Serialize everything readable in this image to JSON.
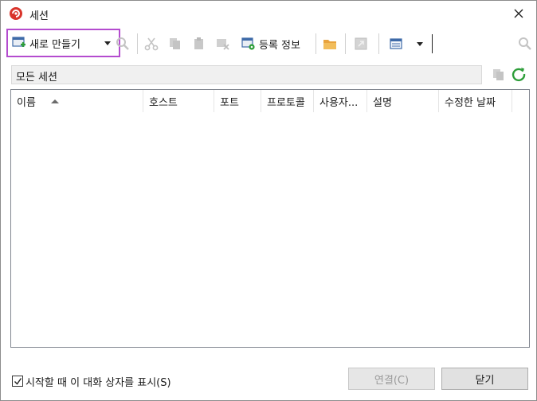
{
  "window": {
    "title": "세션",
    "close_icon": "close-icon"
  },
  "toolbar": {
    "new_session_label": "새로 만들기",
    "register_info_label": "등록 정보",
    "search_value": "",
    "icons": [
      "new-session-icon",
      "find-icon",
      "cut-icon",
      "copy-icon",
      "paste-icon",
      "delete-icon",
      "register-info-icon",
      "open-folder-icon",
      "shortcut-icon",
      "view-mode-icon",
      "search-icon"
    ]
  },
  "filter": {
    "label": "모든 세션"
  },
  "list": {
    "columns": [
      "이름",
      "호스트",
      "포트",
      "프로토콜",
      "사용자...",
      "설명",
      "수정한 날짜"
    ],
    "sort_column": "이름",
    "sort_direction": "ascending",
    "rows": []
  },
  "footer": {
    "show_on_startup_label": "시작할 때 이 대화 상자를 표시(S)",
    "show_on_startup_checked": true,
    "connect_label": "연결(C)",
    "close_label": "닫기"
  },
  "colors": {
    "highlight_border": "#b44ccf",
    "refresh_green": "#2e9e3a",
    "folder_orange": "#e8a33d",
    "app_red": "#d9342b"
  }
}
